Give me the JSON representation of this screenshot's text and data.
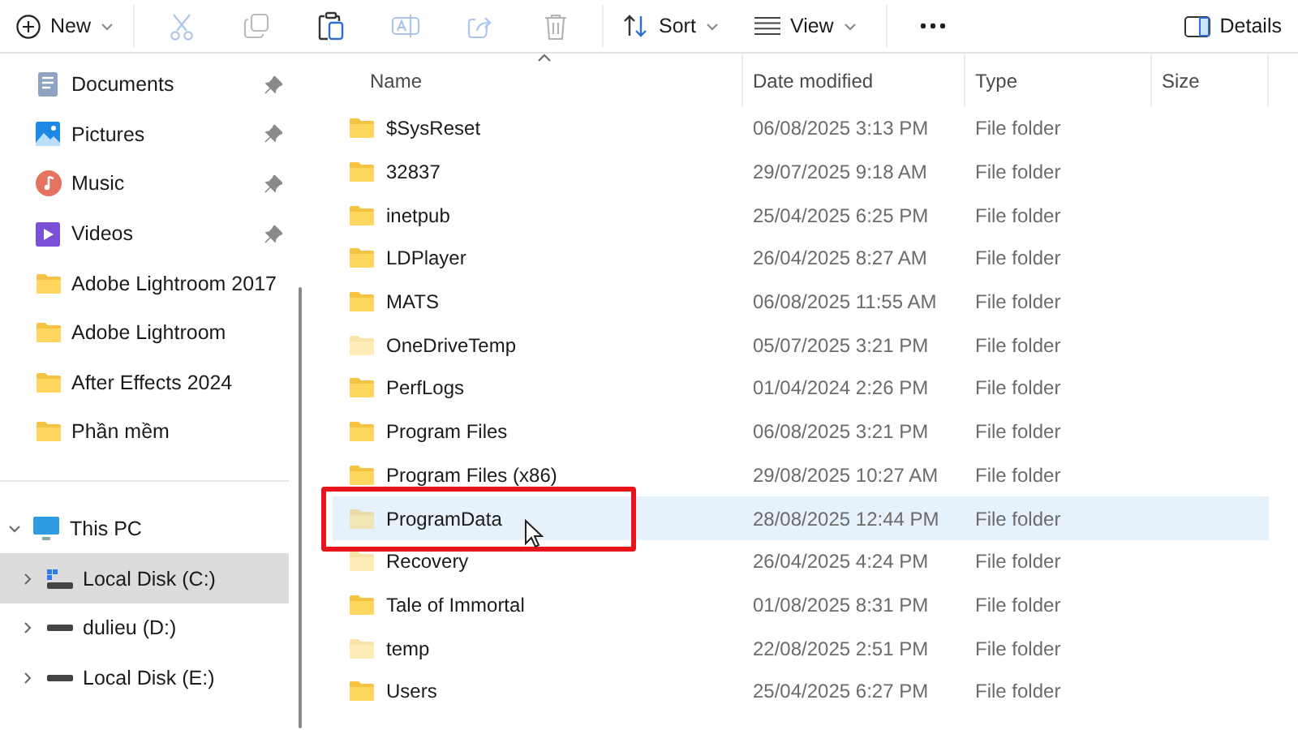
{
  "toolbar": {
    "new": {
      "label": "New"
    },
    "tools": [
      {
        "kind": "cut",
        "disabled": true
      },
      {
        "kind": "copy",
        "disabled": true
      },
      {
        "kind": "paste",
        "disabled": false
      },
      {
        "kind": "rename",
        "disabled": true
      },
      {
        "kind": "share",
        "disabled": true
      },
      {
        "kind": "delete",
        "disabled": true
      }
    ],
    "sort": {
      "label": "Sort"
    },
    "view": {
      "label": "View"
    },
    "details": {
      "label": "Details"
    }
  },
  "sidebar": {
    "quick_access": [
      {
        "label": "Documents",
        "kind": "documents",
        "pinned": true,
        "selected": false
      },
      {
        "label": "Pictures",
        "kind": "pictures",
        "pinned": true,
        "selected": false
      },
      {
        "label": "Music",
        "kind": "music",
        "pinned": true,
        "selected": false
      },
      {
        "label": "Videos",
        "kind": "videos",
        "pinned": true,
        "selected": false
      },
      {
        "label": "Adobe Lightroom 2017",
        "kind": "folder",
        "pinned": false,
        "selected": false
      },
      {
        "label": "Adobe Lightroom",
        "kind": "folder",
        "pinned": false,
        "selected": false
      },
      {
        "label": "After Effects 2024",
        "kind": "folder",
        "pinned": false,
        "selected": false
      },
      {
        "label": "Phần mềm",
        "kind": "folder",
        "pinned": false,
        "selected": false
      }
    ],
    "tree": [
      {
        "label": "This PC",
        "kind": "pc",
        "expanded": true,
        "selected": false,
        "children": [
          {
            "label": "Local Disk (C:)",
            "kind": "system-drive",
            "expanded": false,
            "selected": true
          },
          {
            "label": "dulieu (D:)",
            "kind": "drive",
            "expanded": false,
            "selected": false
          },
          {
            "label": "Local Disk (E:)",
            "kind": "drive",
            "expanded": false,
            "selected": false
          }
        ]
      }
    ]
  },
  "table": {
    "columns": [
      {
        "label": "Name",
        "sorted": true
      },
      {
        "label": "Date modified",
        "sorted": false
      },
      {
        "label": "Type",
        "sorted": false
      },
      {
        "label": "Size",
        "sorted": false
      }
    ],
    "highlight_frame": true,
    "mouse_pointer": true,
    "rows": [
      {
        "name": "$SysReset",
        "date": "06/08/2025 3:13 PM",
        "type": "File folder",
        "hidden": false,
        "selected": false
      },
      {
        "name": "32837",
        "date": "29/07/2025 9:18 AM",
        "type": "File folder",
        "hidden": false,
        "selected": false
      },
      {
        "name": "inetpub",
        "date": "25/04/2025 6:25 PM",
        "type": "File folder",
        "hidden": false,
        "selected": false
      },
      {
        "name": "LDPlayer",
        "date": "26/04/2025 8:27 AM",
        "type": "File folder",
        "hidden": false,
        "selected": false
      },
      {
        "name": "MATS",
        "date": "06/08/2025 11:55 AM",
        "type": "File folder",
        "hidden": false,
        "selected": false
      },
      {
        "name": "OneDriveTemp",
        "date": "05/07/2025 3:21 PM",
        "type": "File folder",
        "hidden": true,
        "selected": false
      },
      {
        "name": "PerfLogs",
        "date": "01/04/2024 2:26 PM",
        "type": "File folder",
        "hidden": false,
        "selected": false
      },
      {
        "name": "Program Files",
        "date": "06/08/2025 3:21 PM",
        "type": "File folder",
        "hidden": false,
        "selected": false
      },
      {
        "name": "Program Files (x86)",
        "date": "29/08/2025 10:27 AM",
        "type": "File folder",
        "hidden": false,
        "selected": false
      },
      {
        "name": "ProgramData",
        "date": "28/08/2025 12:44 PM",
        "type": "File folder",
        "hidden": true,
        "selected": true
      },
      {
        "name": "Recovery",
        "date": "26/04/2025 4:24 PM",
        "type": "File folder",
        "hidden": true,
        "selected": false
      },
      {
        "name": "Tale of Immortal",
        "date": "01/08/2025 8:31 PM",
        "type": "File folder",
        "hidden": false,
        "selected": false
      },
      {
        "name": "temp",
        "date": "22/08/2025 2:51 PM",
        "type": "File folder",
        "hidden": true,
        "selected": false
      },
      {
        "name": "Users",
        "date": "25/04/2025 6:27 PM",
        "type": "File folder",
        "hidden": false,
        "selected": false
      }
    ]
  }
}
